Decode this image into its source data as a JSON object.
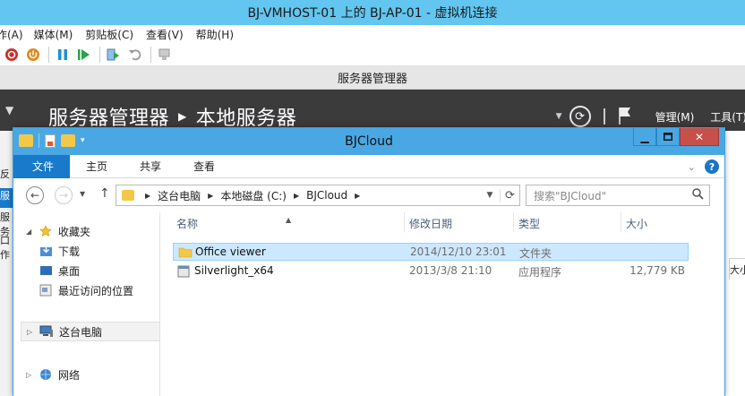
{
  "vm": {
    "title": "BJ-VMHOST-01 上的 BJ-AP-01 - 虚拟机连接",
    "menu": [
      "作(A)",
      "媒体(M)",
      "剪贴板(C)",
      "查看(V)",
      "帮助(H)"
    ]
  },
  "server_manager": {
    "strip_title": "服务器管理器",
    "breadcrumb_root": "服务器管理器",
    "breadcrumb_page": "本地服务器",
    "manage": "管理(M)",
    "tools": "工具(T)",
    "left_fragments": [
      "反",
      "服",
      "服务",
      "口作"
    ],
    "right_fragment": "大小"
  },
  "explorer": {
    "title": "BJCloud",
    "ribbon_tabs": [
      "文件",
      "主页",
      "共享",
      "查看"
    ],
    "address": [
      "这台电脑",
      "本地磁盘 (C:)",
      "BJCloud"
    ],
    "search_placeholder": "搜索\"BJCloud\"",
    "nav": {
      "favorites": "收藏夹",
      "downloads": "下载",
      "desktop": "桌面",
      "recent": "最近访问的位置",
      "this_pc": "这台电脑",
      "network": "网络"
    },
    "columns": {
      "name": "名称",
      "date": "修改日期",
      "type": "类型",
      "size": "大小"
    },
    "files": [
      {
        "name": "Office viewer",
        "date": "2014/12/10 23:01",
        "type": "文件夹",
        "size": ""
      },
      {
        "name": "Silverlight_x64",
        "date": "2013/3/8 21:10",
        "type": "应用程序",
        "size": "12,779 KB"
      }
    ]
  },
  "colors": {
    "vm_title_bg": "#62c6f0",
    "explorer_title_bg": "#49a8e4",
    "file_tab": "#1979ca",
    "close_button": "#c7504a",
    "selection": "#cce8ff",
    "sm_header_bg": "#3b3b3b"
  }
}
